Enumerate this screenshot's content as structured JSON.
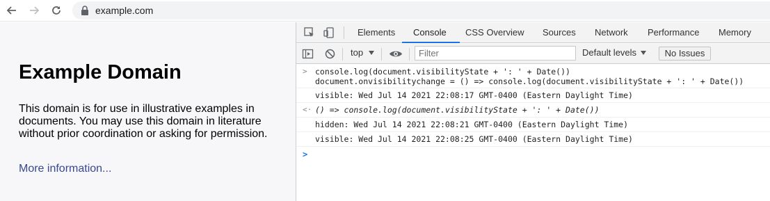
{
  "browser": {
    "url": "example.com",
    "icons": [
      "back-arrow-icon",
      "forward-arrow-icon",
      "reload-icon",
      "lock-icon"
    ]
  },
  "page": {
    "title": "Example Domain",
    "body": "This domain is for use in illustrative examples in documents. You may use this domain in literature without prior coordination or asking for permission.",
    "link": "More information..."
  },
  "devtools": {
    "tabs": [
      "Elements",
      "Console",
      "CSS Overview",
      "Sources",
      "Network",
      "Performance",
      "Memory"
    ],
    "active_tab": "Console",
    "toolbar": {
      "context": "top",
      "filter_placeholder": "Filter",
      "levels": "Default levels",
      "issues": "No Issues"
    },
    "console": {
      "lines": [
        {
          "type": "input",
          "text1": "console.log(document.visibilityState + ': ' + Date())",
          "text2": "document.onvisibilitychange = () => console.log(document.visibilityState + ': ' + Date())"
        },
        {
          "type": "log",
          "text": "visible: Wed Jul 14 2021 22:08:17 GMT-0400 (Eastern Daylight Time)"
        },
        {
          "type": "result",
          "text": "() => console.log(document.visibilityState + ': ' + Date())"
        },
        {
          "type": "log",
          "text": "hidden: Wed Jul 14 2021 22:08:21 GMT-0400 (Eastern Daylight Time)"
        },
        {
          "type": "log",
          "text": "visible: Wed Jul 14 2021 22:08:25 GMT-0400 (Eastern Daylight Time)"
        }
      ]
    }
  },
  "colors": {
    "link": "#38488f",
    "accent": "#1a73e8",
    "string": "#c41a16"
  }
}
